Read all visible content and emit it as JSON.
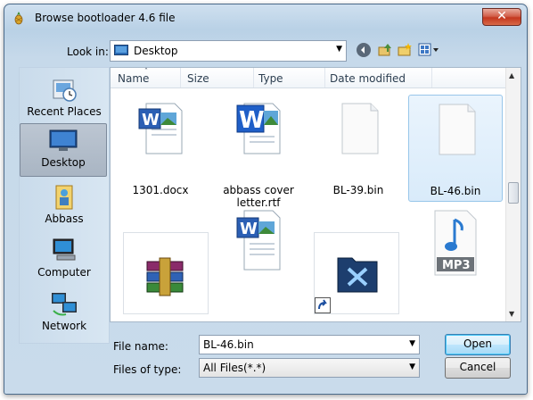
{
  "window": {
    "title": "Browse bootloader 4.6 file",
    "close_glyph": "✕"
  },
  "toolbar": {
    "look_in_label": "Look in:",
    "look_in_value": "Desktop",
    "buttons": [
      "back-icon",
      "up-folder-icon",
      "new-folder-icon",
      "views-menu-icon"
    ]
  },
  "places": [
    {
      "label": "Recent Places",
      "icon": "recent-places-icon"
    },
    {
      "label": "Desktop",
      "icon": "desktop-icon",
      "selected": true
    },
    {
      "label": "Abbass",
      "icon": "user-folder-icon"
    },
    {
      "label": "Computer",
      "icon": "computer-icon"
    },
    {
      "label": "Network",
      "icon": "network-icon"
    }
  ],
  "columns": [
    "Name",
    "Size",
    "Type",
    "Date modified"
  ],
  "files": [
    {
      "name": "1301.docx",
      "icon": "word-doc-icon"
    },
    {
      "name": "abbass cover letter.rtf",
      "line1": "abbass cover",
      "line2": "letter.rtf",
      "icon": "word-rtf-icon"
    },
    {
      "name": "BL-39.bin",
      "icon": "blank-file-icon"
    },
    {
      "name": "BL-46.bin",
      "icon": "blank-file-icon",
      "selected": true
    },
    {
      "name": "",
      "icon": "winrar-archive-icon"
    },
    {
      "name": "",
      "icon": "word-doc-icon"
    },
    {
      "name": "",
      "icon": "shortcut-folder-icon"
    },
    {
      "name": "",
      "icon": "mp3-file-icon",
      "badge": "MP3"
    }
  ],
  "filename": {
    "label": "File name:",
    "value": "BL-46.bin"
  },
  "filetype": {
    "label": "Files of type:",
    "value": "All Files(*.*)"
  },
  "buttons": {
    "open": "Open",
    "cancel": "Cancel"
  },
  "colors": {
    "selection_bg": "#d9ebfa",
    "selection_border": "#98c6ea",
    "title_bg": "#b9d1e6"
  }
}
